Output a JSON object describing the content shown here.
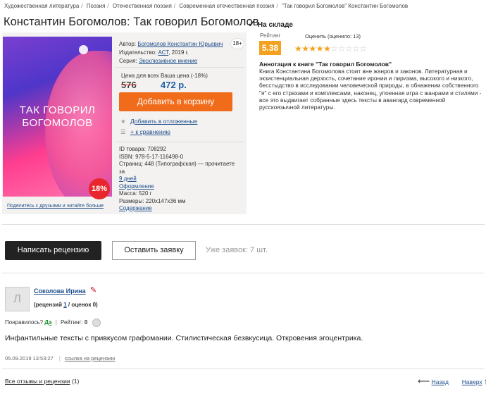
{
  "breadcrumbs": [
    "Художественная литература",
    "Поэзия",
    "Отечественная поэзия",
    "Современная отечественная поэзия",
    "\"Так говорил Богомолов\" Константин Богомолов"
  ],
  "title": "Константин Богомолов: Так говорил Богомолов",
  "stock": "На складе",
  "cover": {
    "title_line1": "ТАК ГОВОРИЛ",
    "title_line2": "БОГОМОЛОВ",
    "discount": "18%",
    "share": "Поделитесь с друзьями и читайте больше"
  },
  "meta": {
    "author_label": "Автор:",
    "author": "Богомолов Константин Юрьевич",
    "publisher_label": "Издательство:",
    "publisher": "АСТ",
    "year": ", 2019 г.",
    "series_label": "Серия:",
    "series": "Эксклюзивное мнение",
    "age": "18+"
  },
  "price": {
    "all_label": "Цена для всех",
    "your_label": "Ваша цена (-18%)",
    "old": "576",
    "new": "472 р.",
    "cart_button": "Добавить в корзину",
    "wishlist": "Добавить в отложенные",
    "compare": "+ к сравнению"
  },
  "specs": {
    "id": "ID товара: 708292",
    "isbn": "ISBN: 978-5-17-116498-0",
    "pages": "Страниц: 448 (Типографская) — прочитаете за",
    "days": "9 дней",
    "design": "Оформление",
    "weight": "Масса: 520 г",
    "size": "Размеры: 220x147x36 мм",
    "contents": "Содержание"
  },
  "rating": {
    "label": "Рейтинг",
    "value": "5.38",
    "caption": "Оценить (оценило: 13)",
    "stars_filled": 5,
    "stars_total": 10
  },
  "annotation": {
    "heading": "Аннотация к книге \"Так говорил Богомолов\"",
    "text": "Книга Константина Богомолова стоит вне жанров и законов. Литературная и экзистенциальная дерзость, сочетание иронии и лиризма, высокого и низкого, бесстыдство в исследовании человеческой природы, в обнажении собственного \"я\" с его страхами и комплексами, наконец, упоенная игра с жанрами и стилями - все это выдвигает собранные здесь тексты в авангард современной русскоязычной литературы."
  },
  "actions": {
    "write_review": "Написать рецензию",
    "leave_request": "Оставить заявку",
    "queue": "Уже заявок: 7 шт."
  },
  "review": {
    "avatar_letter": "Л",
    "author": "Соколова Ирина",
    "stats_prefix": "(рецензий ",
    "reviews_count": "1",
    "stats_mid": " / оценок ",
    "ratings_count": "0",
    "stats_suffix": ")",
    "helpful_label": "Понравилось?",
    "helpful_yes": "Да",
    "helpful_sep": "|",
    "rating_label": "Рейтинг:",
    "rating_value": "0",
    "text": "Инфантильные тексты с привкусом графомании. Стилистическая безвкусица. Откровения эгоцентрика.",
    "date": "05.09.2019 13:53:27",
    "link": "ссылка на рецензию"
  },
  "footer": {
    "all_reviews": "Все отзывы и рецензии",
    "count": "(1)",
    "back": "Назад",
    "up": "Наверх"
  },
  "colors": {
    "accent_orange": "#f16c1a",
    "rating_orange": "#f4a11f",
    "link_blue": "#1f4e8c",
    "sale_red": "#e8262c"
  }
}
